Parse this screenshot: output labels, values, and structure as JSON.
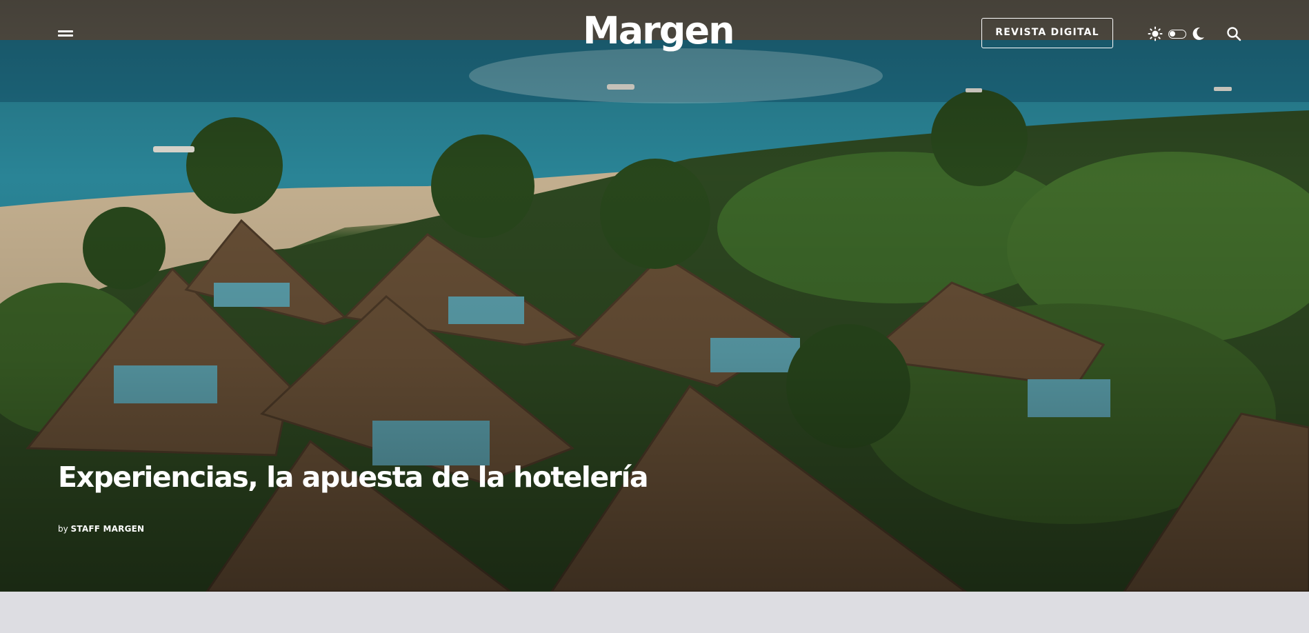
{
  "header": {
    "menu_icon": "hamburger-menu-icon",
    "logo": "Margen",
    "revista_button": "REVISTA DIGITAL",
    "theme_icons": [
      "sun-icon",
      "toggle-switch",
      "moon-icon"
    ],
    "search_icon": "search-icon"
  },
  "hero": {
    "title": "Experiencias, la apuesta de la hotelería",
    "byline_prefix": "by",
    "author": "STAFF MARGEN"
  },
  "colors": {
    "text": "#ffffff",
    "page_bottom": "#dddde2",
    "sea": "#2a8fa0",
    "jungle": "#2f4a22",
    "thatch": "#6b5238"
  }
}
